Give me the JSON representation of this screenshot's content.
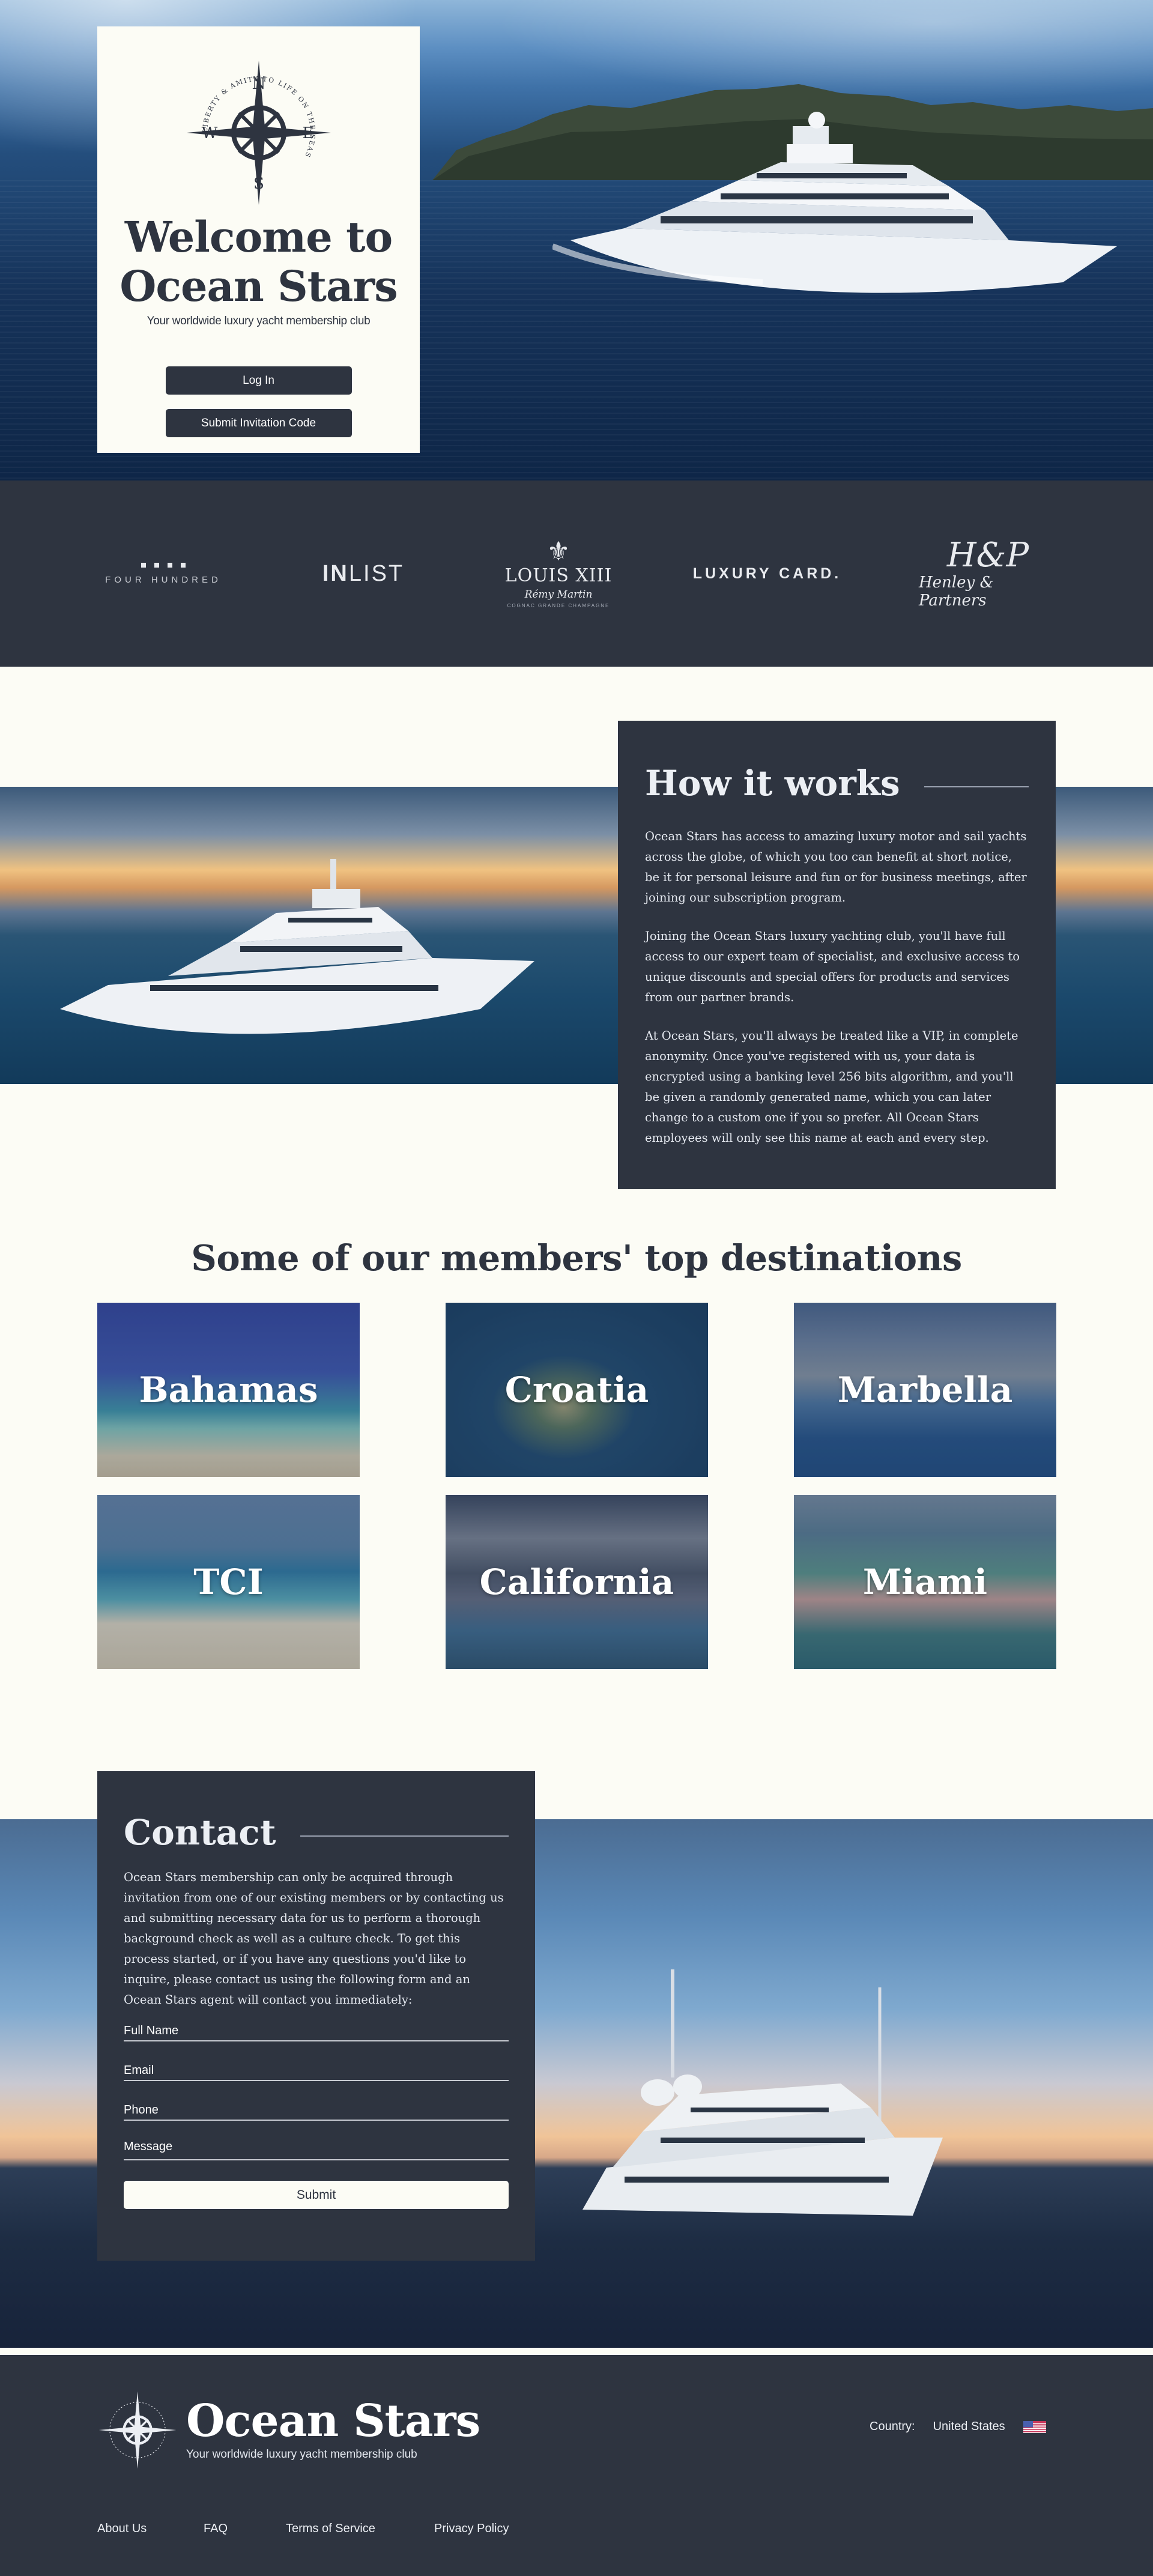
{
  "hero": {
    "emblem": {
      "north": "N",
      "south": "S",
      "east": "E",
      "west": "W",
      "ring_text": "LIBERTY & AMITY TO LIFE ON THE SEAS"
    },
    "title_line1": "Welcome to",
    "title_line2": "Ocean Stars",
    "subtitle": "Your worldwide luxury yacht membership club",
    "login_label": "Log In",
    "invite_label": "Submit Invitation Code"
  },
  "partners": [
    {
      "name": "FOUR HUNDRED"
    },
    {
      "name_bold": "IN",
      "name_light": "LIST"
    },
    {
      "name": "LOUIS XIII",
      "sub1": "Rémy Martin",
      "sub2": "COGNAC GRANDE CHAMPAGNE"
    },
    {
      "name": "LUXURY CARD."
    },
    {
      "monogram": "H&P",
      "name": "Henley & Partners"
    }
  ],
  "how": {
    "title": "How it works",
    "paragraphs": [
      "Ocean Stars has access to amazing luxury motor and sail yachts across the globe, of which you too can benefit at short notice, be it for personal leisure and fun or for business meetings, after joining our subscription program.",
      "Joining the Ocean Stars luxury yachting club, you'll have full access to our expert team of specialist, and exclusive access to unique discounts and special offers for products and services from our partner brands.",
      "At Ocean Stars, you'll always be treated like a VIP, in complete anonymity. Once you've registered with us, your data is encrypted using a banking level 256 bits algorithm, and you'll be given a randomly generated name, which you can later change to a custom one if you so prefer. All Ocean Stars employees will only see this name at each and every step."
    ]
  },
  "destinations": {
    "title": "Some of our members' top destinations",
    "items": [
      "Bahamas",
      "Croatia",
      "Marbella",
      "TCI",
      "California",
      "Miami"
    ]
  },
  "contact": {
    "title": "Contact",
    "text": "Ocean Stars membership can only be acquired through invitation from one of our existing members or by contacting us and submitting necessary data for us to perform a thorough background check as well as a culture check. To get this process started, or if you have any questions you'd like to inquire, please contact us using the following form and an Ocean Stars agent will contact you immediately:",
    "fields": {
      "full_name": "Full Name",
      "email": "Email",
      "phone": "Phone",
      "message": "Message"
    },
    "submit_label": "Submit"
  },
  "footer": {
    "name": "Ocean Stars",
    "tagline": "Your worldwide luxury yacht membership club",
    "country_label": "Country:",
    "country_value": "United States",
    "links": [
      "About Us",
      "FAQ",
      "Terms of Service",
      "Privacy Policy"
    ]
  },
  "colors": {
    "primary_dark": "#2e3440",
    "background_cream": "#fcfcf5",
    "text_light": "#eceff4"
  }
}
